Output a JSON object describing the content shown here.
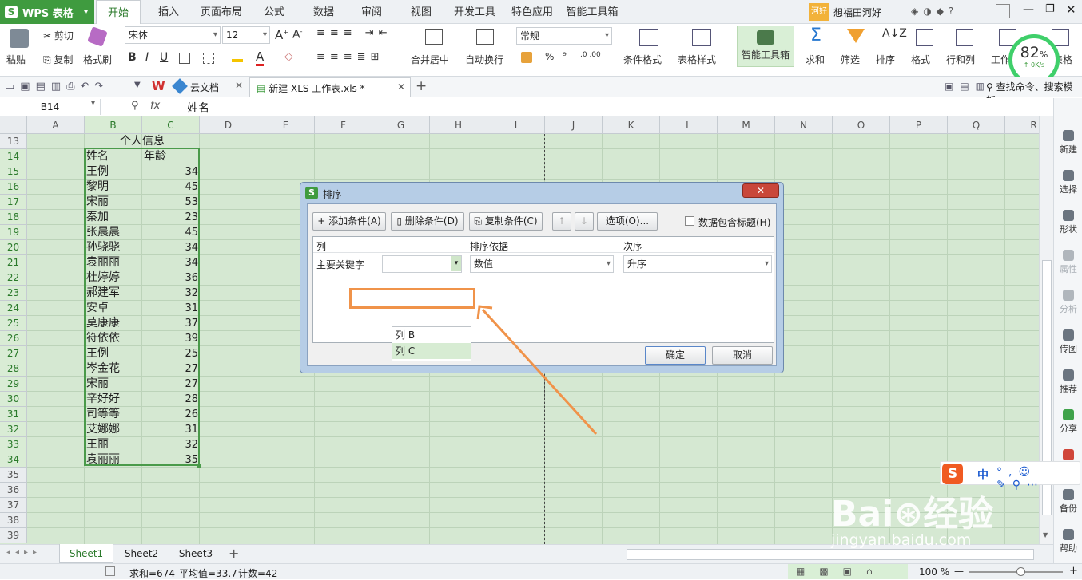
{
  "app": {
    "name": "WPS 表格"
  },
  "menu_tabs": [
    "开始",
    "插入",
    "页面布局",
    "公式",
    "数据",
    "审阅",
    "视图",
    "开发工具",
    "特色应用",
    "智能工具箱"
  ],
  "user": {
    "badge": "河好",
    "name": "想福田河好"
  },
  "ribbon": {
    "paste": "粘贴",
    "cut": "剪切",
    "copy": "复制",
    "format_painter": "格式刷",
    "font_name": "宋体",
    "font_size": "12",
    "merge_center": "合并居中",
    "wrap_text": "自动换行",
    "number_format": "常规",
    "cond_format": "条件格式",
    "table_style": "表格样式",
    "smart_toolbox": "智能工具箱",
    "sum": "求和",
    "filter": "筛选",
    "sort": "排序",
    "format": "格式",
    "row_col": "行和列",
    "worksheet": "工作",
    "grid": "表格",
    "pct": "%",
    "comma": "⁹"
  },
  "speed": {
    "percent": "82",
    "unit": "%",
    "rate": "0K/s"
  },
  "doc_tabs": {
    "cloud": "云文档",
    "file": "新建 XLS 工作表.xls *"
  },
  "search_hint": "查找命令、搜索模板",
  "formula_bar": {
    "cell_ref": "B14",
    "fx": "fx",
    "value": "姓名"
  },
  "columns": [
    "A",
    "B",
    "C",
    "D",
    "E",
    "F",
    "G",
    "H",
    "I",
    "J",
    "K",
    "L",
    "M",
    "N",
    "O",
    "P",
    "Q",
    "R"
  ],
  "rows": [
    "13",
    "14",
    "15",
    "16",
    "17",
    "18",
    "19",
    "20",
    "21",
    "22",
    "23",
    "24",
    "25",
    "26",
    "27",
    "28",
    "29",
    "30",
    "31",
    "32",
    "33",
    "34",
    "35",
    "36",
    "37",
    "38",
    "39"
  ],
  "table": {
    "title": "个人信息",
    "headers": [
      "姓名",
      "年龄"
    ],
    "data": [
      [
        "王例",
        "34"
      ],
      [
        "黎明",
        "45"
      ],
      [
        "宋丽",
        "53"
      ],
      [
        "秦加",
        "23"
      ],
      [
        "张晨晨",
        "45"
      ],
      [
        "孙骁骁",
        "34"
      ],
      [
        "袁丽丽",
        "34"
      ],
      [
        "杜婷婷",
        "36"
      ],
      [
        "郝建军",
        "32"
      ],
      [
        "安卓",
        "31"
      ],
      [
        "莫康康",
        "37"
      ],
      [
        "符依依",
        "39"
      ],
      [
        "王例",
        "25"
      ],
      [
        "岑金花",
        "27"
      ],
      [
        "宋丽",
        "27"
      ],
      [
        "辛好好",
        "28"
      ],
      [
        "司等等",
        "26"
      ],
      [
        "艾娜娜",
        "31"
      ],
      [
        "王丽",
        "32"
      ],
      [
        "袁丽丽",
        "35"
      ]
    ]
  },
  "dialog": {
    "title": "排序",
    "add_condition": "添加条件(A)",
    "delete_condition": "删除条件(D)",
    "copy_condition": "复制条件(C)",
    "options": "选项(O)...",
    "header_checkbox": "数据包含标题(H)",
    "col_header": "列",
    "basis_header": "排序依据",
    "order_header": "次序",
    "row_label": "主要关键字",
    "key_value": "",
    "basis_value": "数值",
    "order_value": "升序",
    "dropdown_options": [
      "列 B",
      "列 C"
    ],
    "ok": "确定",
    "cancel": "取消"
  },
  "right_panel": [
    "新建",
    "选择",
    "形状",
    "属性",
    "分析",
    "传图",
    "推荐",
    "分享",
    "",
    "备份",
    "帮助"
  ],
  "sheets": [
    "Sheet1",
    "Sheet2",
    "Sheet3"
  ],
  "status": {
    "sum": "求和=674",
    "avg": "平均值=33.7",
    "count": "计数=42",
    "zoom": "100 %"
  },
  "ime": {
    "lang": "中"
  },
  "watermark": {
    "site": "jingyan.baidu.com"
  },
  "colors": {
    "accent": "#3f9b3f",
    "grid_bg": "#d5e8d2",
    "highlight": "#f0934a"
  }
}
